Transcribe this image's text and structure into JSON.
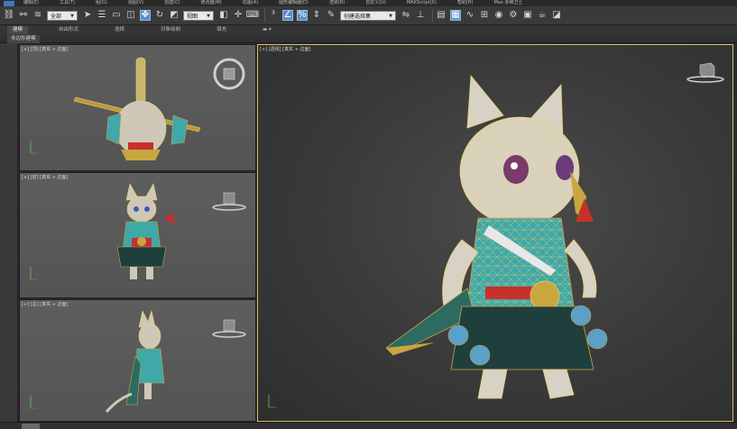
{
  "menubar": {
    "items": [
      "编辑(E)",
      "工具(T)",
      "组(G)",
      "视图(V)",
      "创建(C)",
      "修改器(M)",
      "动画(A)",
      "图形编辑器(D)",
      "渲染(R)",
      "自定义(U)",
      "MAXScript(X)",
      "帮助(H)",
      "Max 多维卫士"
    ]
  },
  "toolbar": {
    "selection_filter": "全部",
    "view_dropdown": "视图",
    "named_selection": "创建选择集"
  },
  "ribbon": {
    "tabs": [
      "建模",
      "自由形式",
      "选择",
      "对象绘制",
      "填充"
    ],
    "selected_tab": "建模",
    "sub_label": "多边形建模"
  },
  "viewports": {
    "top": {
      "label": "[+] [顶] [真实 + 边面]"
    },
    "front": {
      "label": "[+] [前] [真实 + 边面]"
    },
    "left": {
      "label": "[+] [左] [真实 + 边面]"
    },
    "perspective": {
      "label": "[+] [透视] [真实 + 边面]"
    }
  },
  "icons": {
    "menu_logo": "app-logo-icon",
    "viewcube": "viewcube-icon"
  },
  "colors": {
    "active_viewport_border": "#d8c060",
    "toolbar_active": "#5b8fc8",
    "model_teal": "#3fa8a8",
    "model_gold": "#c9a640",
    "model_red": "#c8302c",
    "wire_yellow": "#e8d070"
  }
}
